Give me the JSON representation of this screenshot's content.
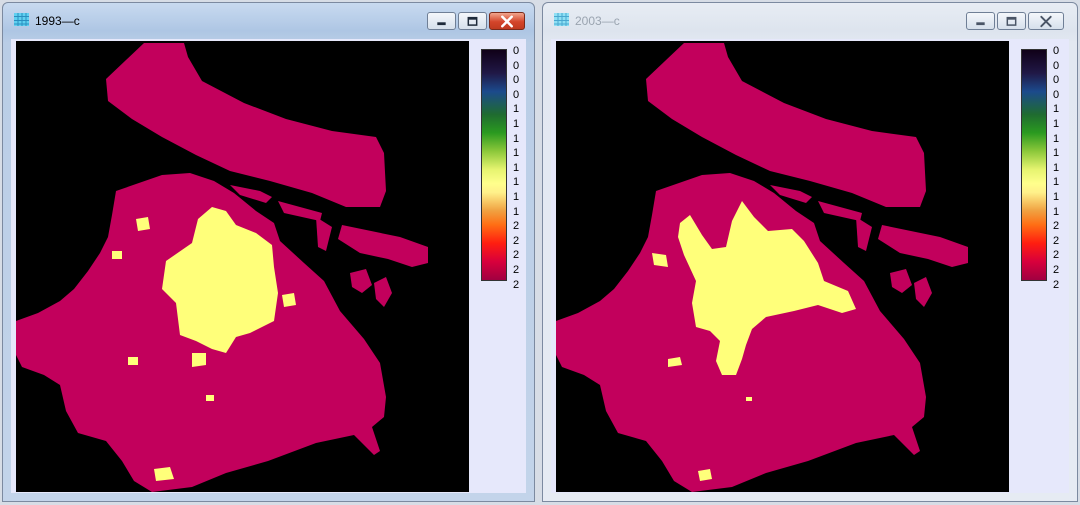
{
  "windows": [
    {
      "title": "1993—c",
      "state": "active",
      "legend_labels": [
        "0",
        "0",
        "0",
        "0",
        "1",
        "1",
        "1",
        "1",
        "1",
        "1",
        "1",
        "1",
        "2",
        "2",
        "2",
        "2",
        "2"
      ]
    },
    {
      "title": "2003—c",
      "state": "inactive",
      "legend_labels": [
        "0",
        "0",
        "0",
        "0",
        "1",
        "1",
        "1",
        "1",
        "1",
        "1",
        "1",
        "1",
        "2",
        "2",
        "2",
        "2",
        "2"
      ]
    }
  ],
  "colors": {
    "land": "#c2005c",
    "urban": "#ffff7a",
    "background": "#000000"
  },
  "icons": {
    "app": "raster-grid-icon",
    "minimize": "minimize-icon",
    "maximize": "maximize-icon",
    "close": "close-icon"
  }
}
